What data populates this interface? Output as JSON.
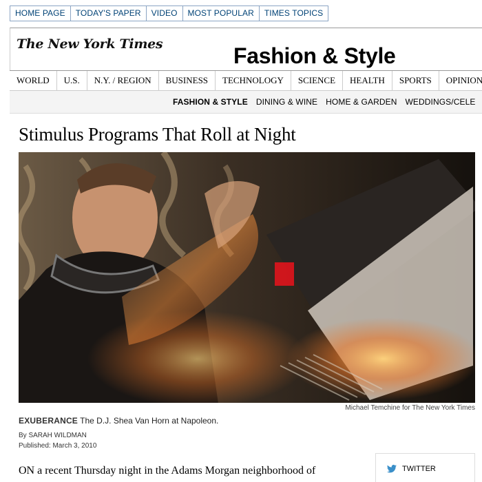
{
  "topnav": {
    "items": [
      "HOME PAGE",
      "TODAY'S PAPER",
      "VIDEO",
      "MOST POPULAR",
      "TIMES TOPICS"
    ]
  },
  "masthead": {
    "logo": "The New York Times",
    "section": "Fashion & Style"
  },
  "mainnav": {
    "items": [
      "WORLD",
      "U.S.",
      "N.Y. / REGION",
      "BUSINESS",
      "TECHNOLOGY",
      "SCIENCE",
      "HEALTH",
      "SPORTS",
      "OPINION"
    ]
  },
  "subnav": {
    "items": [
      "FASHION & STYLE",
      "DINING & WINE",
      "HOME & GARDEN",
      "WEDDINGS/CELE"
    ],
    "active": "FASHION & STYLE"
  },
  "article": {
    "headline": "Stimulus Programs That Roll at Night",
    "photo_credit": "Michael Temchine for The New York Times",
    "caption_lead": "EXUBERANCE",
    "caption_text": " The D.J. Shea Van Horn at Napoleon.",
    "byline_prefix": "By ",
    "author": "SARAH WILDMAN",
    "published": "Published: March 3, 2010",
    "body_start": "ON a recent Thursday night in the Adams Morgan neighborhood of Washington, D.C., the D.J. Shea Van Horn and Ferrari Carpella"
  },
  "share": {
    "twitter_label": "TWITTER",
    "accent": "#3a8fc9"
  },
  "colors": {
    "link_blue": "#004276",
    "nav_border": "#8ba4c3"
  }
}
